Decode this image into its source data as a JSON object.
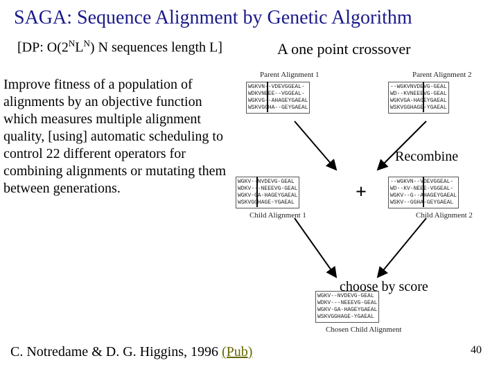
{
  "title": "SAGA: Sequence Alignment by Genetic Algorithm",
  "complexity_prefix": "[DP: O(2",
  "complexity_sup1": "N",
  "complexity_mid": "L",
  "complexity_sup2": "N",
  "complexity_suffix": ")  N sequences length L]",
  "crossover_label": "A one point crossover",
  "body": "Improve fitness of a population of alignments by an objective function which measures multiple alignment quality, [using] automatic scheduling to control 22 different operators for combining alignments or mutating them between generations.",
  "recombine": "Recombine",
  "choose": "choose by score",
  "citation_text": "C. Notredame & D. G. Higgins, 1996 ",
  "pub_link": "(Pub)",
  "page_number": "40",
  "diagram": {
    "parent1_label": "Parent Alignment 1",
    "parent2_label": "Parent Alignment 2",
    "child1_label": "Child Alignment 1",
    "child2_label": "Child Alignment 2",
    "chosen_label": "Chosen Child Alignment",
    "parent1_seq": "WGKVN--VDEVGGEAL-\nWDKVNEEE--VGGEAL-\nWGKVG--AHAGEYGAEAL\nWSKVGGHA--GEYGAEAL",
    "parent2_seq": "--WGKVNVDEVG-GEAL\nWD--KVNEEEVG-GEAL\nWGKVGA-HAGEYGAEAL\nWSKVGGHAGE-YGAEAL",
    "child1_seq": "WGKV--NVDEVG-GEAL\nWDKV---NEEEVG-GEAL\nWGKV-GA-HAGEYGAEAL\nWSKVGGHAGE-YGAEAL",
    "child2_seq": "--WGKVN--VDEVGGEAL-\nWD--KV-NEEE-VGGEAL-\nWGKV--G--AHAGEYGAEAL\nWSKV--GGHA-GEYGAEAL",
    "chosen_seq": "WGKV--NVDEVG-GEAL\nWDKV---NEEEVG-GEAL\nWGKV-GA-HAGEYGAEAL\nWSKVGGHAGE-YGAEAL"
  }
}
